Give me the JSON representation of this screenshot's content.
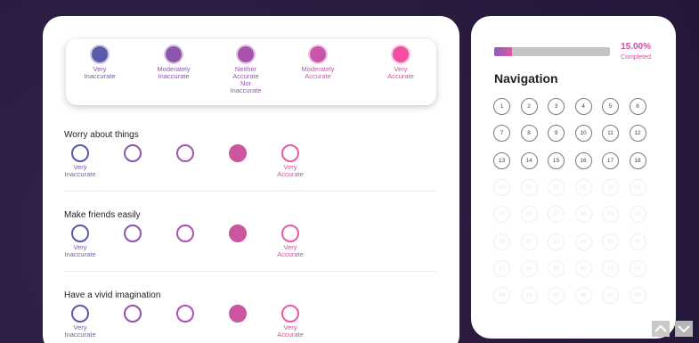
{
  "colors": {
    "scale": [
      "#5a5aa8",
      "#8d55ac",
      "#a853ae",
      "#c954a8",
      "#f0509f"
    ],
    "labels": [
      "#7a5ba9",
      "#8d55ac",
      "#9a56ae",
      "#c258a6",
      "#d04fa0"
    ],
    "selected": "#cc55a0",
    "brand_pink": "#d24ea0"
  },
  "legend": [
    {
      "label": "Very\nInaccurate"
    },
    {
      "label": "Moderately\nInaccurate"
    },
    {
      "label": "Neither\nAccurate\nNor\nInaccurate"
    },
    {
      "label": "Moderately\nAccurate"
    },
    {
      "label": "Very\nAccurate"
    }
  ],
  "questions": [
    {
      "text": "Worry about things",
      "selected_index": 3,
      "low_label": "Very\nInaccurate",
      "high_label": "Very\nAccurate"
    },
    {
      "text": "Make friends easily",
      "selected_index": 3,
      "low_label": "Very\nInaccurate",
      "high_label": "Very\nAccurate"
    },
    {
      "text": "Have a vivid imagination",
      "selected_index": 3,
      "low_label": "Very\nInaccurate",
      "high_label": "Very\nAccurate"
    }
  ],
  "progress": {
    "percent_text": "15.00%",
    "fraction": 0.15,
    "caption": "Completed"
  },
  "navigation": {
    "title": "Navigation",
    "answered_count": 18,
    "numbers": [
      "1",
      "2",
      "3",
      "4",
      "5",
      "6",
      "7",
      "8",
      "9",
      "10",
      "11",
      "12",
      "13",
      "14",
      "15",
      "16",
      "17",
      "18",
      "19",
      "20",
      "21",
      "22",
      "23",
      "24",
      "25",
      "26",
      "27",
      "28",
      "29",
      "30",
      "31",
      "32",
      "33",
      "34",
      "35",
      "36",
      "37",
      "38",
      "39",
      "40",
      "41",
      "42",
      "43",
      "44",
      "45",
      "46",
      "47",
      "48"
    ]
  },
  "icons": {
    "scroll_up": "chevron-up-icon",
    "scroll_down": "chevron-down-icon"
  }
}
